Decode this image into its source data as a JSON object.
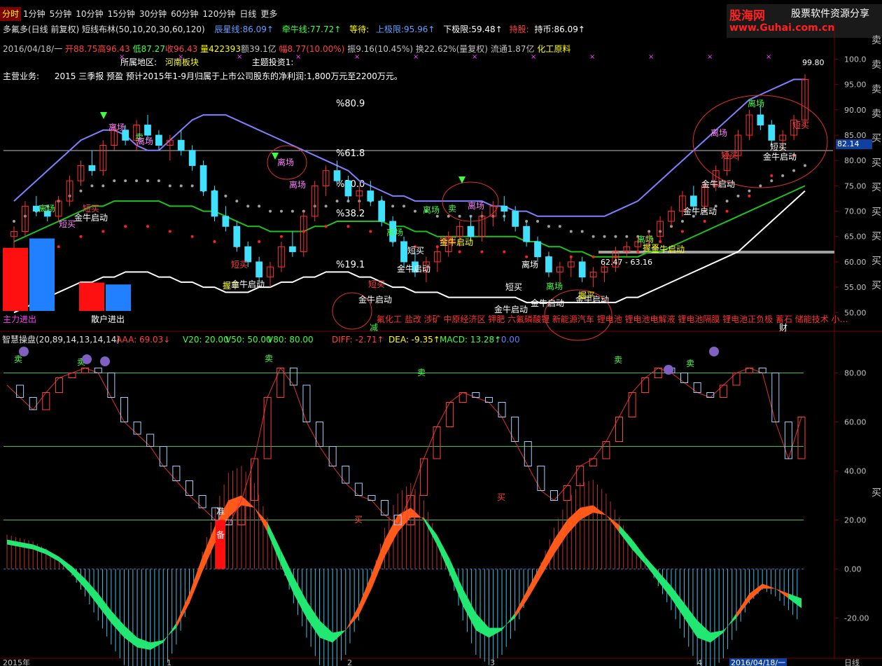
{
  "tabs": [
    "分时",
    "1分钟",
    "5分钟",
    "10分钟",
    "15分钟",
    "30分钟",
    "60分钟",
    "120分钟",
    "日线",
    "更多"
  ],
  "active_tab": "分时",
  "logo": {
    "name": "股海网",
    "tagline": "股票软件资源分享",
    "url": "www.Guhai.com.cn"
  },
  "info": {
    "indicator_title": "多氟多(日线 前复权) 短线布林(50,10,20,30,60,120)",
    "chenxing_label": "辰星线:",
    "chenxing_value": "86.09↑",
    "qianniu_label": "牵牛线:",
    "qianniu_value": "77.72↑",
    "dengdai_label": "等待:",
    "upper_label": "上极限:",
    "upper_value": "95.96↑",
    "lower_label": "下极限:",
    "lower_value": "59.48↑",
    "chigu_label": "持股:",
    "chishi_label": "持币:",
    "chishi_value": "86.09↑",
    "date": "2016/04/18/一",
    "open": "开88.75",
    "high": "高96.43",
    "low": "低87.27",
    "close": "收96.43",
    "volume": "量422393",
    "amount": "额39.1亿",
    "change": "幅8.77(10.00%)",
    "amplitude": "振9.16(10.45%)",
    "turnover": "换22.62%(量复权)",
    "float": "流通1.87亿",
    "industry": "化工原料",
    "region_label": "所属地区:",
    "region_value": "河南板块",
    "theme_label": "主题投资1:",
    "business_label": "主营业务:",
    "business_text": "2015 三季报 预盈 预计2015年1-9月归属于上市公司股东的净利润:1,800万元至2200万元。"
  },
  "fib_labels": [
    "%80.9",
    "%61.8",
    "%50.0",
    "%38.2",
    "%19.1"
  ],
  "price_tag": "82.14",
  "range_label": "62.47 - 63.16",
  "peak_label": "99.80",
  "concepts": "氟化工 盐改 涉矿 中原经济区 钾肥 六氟磷酸锂 新能源汽车 锂电池 锂电池电解液 锂电池隔膜 锂电池正负极 蓄石 储能技术 小…",
  "main_markers": {
    "likai": "离场",
    "maichu": "卖",
    "duanmai": "短买",
    "jinniu": "金牛启动",
    "wodi": "握平",
    "jian": "减",
    "cai": "财"
  },
  "bars_legend": "散户进出",
  "bars_left_label": "主力进出",
  "bottom_indicator": {
    "title": "智慧操盘(20,89,14,13,14,14)",
    "aaa": "AAA: 69.03↓",
    "v20": "V20: 20.00",
    "v50": "V50: 50.00",
    "v80": "V80: 80.00",
    "diff": "DIFF: -2.71↑",
    "dea": "DEA: -9.35↑",
    "macd": "MACD: 13.28↑",
    "macd2": ": 0.00",
    "markers": {
      "sell": "卖",
      "buy": "买",
      "zhun": "准",
      "bei": "备"
    }
  },
  "right_side_labels": {
    "buy": "买",
    "sell": "卖"
  },
  "time_axis": [
    "2015年",
    "1",
    "2",
    "3",
    "4",
    "2016/04/18/一",
    "日线"
  ],
  "chart_data": [
    {
      "type": "candlestick",
      "title": "多氟多(日线 前复权) 短线布林(50,10,20,30,60,120)",
      "ylim": [
        47,
        102
      ],
      "y_ticks": [
        50,
        55,
        60,
        65,
        70,
        75,
        80,
        85,
        90,
        95,
        100
      ],
      "y_tick_labels": [
        "50.00",
        "55.00",
        "60.00",
        "65.00",
        "70.00",
        "75.00",
        "80.00",
        "85.00",
        "90.00",
        "95.00",
        "100.0"
      ],
      "candles": [
        [
          65,
          67,
          62,
          66
        ],
        [
          66,
          72,
          65,
          71
        ],
        [
          71,
          73,
          69,
          70
        ],
        [
          70,
          71,
          68,
          69
        ],
        [
          69,
          73,
          68,
          72
        ],
        [
          72,
          77,
          71,
          76
        ],
        [
          76,
          80,
          75,
          79
        ],
        [
          79,
          82,
          77,
          78
        ],
        [
          78,
          84,
          77,
          83
        ],
        [
          83,
          87,
          82,
          86
        ],
        [
          86,
          87,
          83,
          84
        ],
        [
          84,
          88,
          82,
          87
        ],
        [
          87,
          89,
          84,
          85
        ],
        [
          85,
          86,
          82,
          83
        ],
        [
          83,
          85,
          80,
          84
        ],
        [
          84,
          86,
          81,
          82
        ],
        [
          82,
          83,
          78,
          79
        ],
        [
          79,
          80,
          73,
          74
        ],
        [
          74,
          75,
          68,
          69
        ],
        [
          69,
          71,
          66,
          67
        ],
        [
          67,
          68,
          62,
          63
        ],
        [
          63,
          64,
          59,
          60
        ],
        [
          60,
          61,
          56,
          57
        ],
        [
          57,
          60,
          55,
          59
        ],
        [
          59,
          64,
          58,
          63
        ],
        [
          63,
          66,
          61,
          62
        ],
        [
          62,
          70,
          61,
          69
        ],
        [
          69,
          76,
          68,
          75
        ],
        [
          75,
          79,
          73,
          78
        ],
        [
          78,
          80,
          75,
          76
        ],
        [
          76,
          77,
          72,
          73
        ],
        [
          73,
          75,
          70,
          74
        ],
        [
          74,
          76,
          71,
          72
        ],
        [
          72,
          73,
          67,
          68
        ],
        [
          68,
          69,
          63,
          64
        ],
        [
          64,
          65,
          59,
          60
        ],
        [
          60,
          62,
          57,
          58
        ],
        [
          58,
          61,
          56,
          60
        ],
        [
          60,
          63,
          58,
          62
        ],
        [
          62,
          66,
          61,
          65
        ],
        [
          65,
          68,
          63,
          67
        ],
        [
          67,
          69,
          64,
          65
        ],
        [
          65,
          70,
          64,
          69
        ],
        [
          69,
          72,
          67,
          71
        ],
        [
          71,
          73,
          68,
          70
        ],
        [
          70,
          71,
          66,
          67
        ],
        [
          67,
          68,
          63,
          64
        ],
        [
          64,
          65,
          60,
          61
        ],
        [
          61,
          62,
          57,
          58
        ],
        [
          58,
          60,
          56,
          59
        ],
        [
          59,
          61,
          57,
          60
        ],
        [
          60,
          61,
          56,
          57
        ],
        [
          57,
          59,
          55,
          58
        ],
        [
          58,
          60,
          56,
          59
        ],
        [
          59,
          63,
          58,
          62
        ],
        [
          62,
          64,
          61,
          63
        ],
        [
          63,
          65,
          62,
          64
        ],
        [
          64,
          66,
          63,
          65
        ],
        [
          65,
          69,
          64,
          68
        ],
        [
          68,
          71,
          67,
          70
        ],
        [
          70,
          74,
          69,
          73
        ],
        [
          73,
          75,
          70,
          71
        ],
        [
          71,
          76,
          70,
          75
        ],
        [
          75,
          79,
          74,
          78
        ],
        [
          78,
          82,
          77,
          81
        ],
        [
          81,
          86,
          80,
          85
        ],
        [
          85,
          90,
          84,
          89
        ],
        [
          89,
          91,
          86,
          87
        ],
        [
          87,
          88,
          83,
          84
        ],
        [
          84,
          86,
          82,
          85
        ],
        [
          85,
          89,
          84,
          88
        ],
        [
          88,
          97,
          87,
          96
        ]
      ],
      "upper_band": [
        72,
        74,
        76,
        78,
        80,
        82,
        84,
        85,
        86,
        86,
        85,
        83,
        82,
        82,
        84,
        86,
        88,
        89,
        89,
        89,
        88,
        87,
        86,
        85,
        84,
        83,
        82,
        81,
        80,
        79,
        78,
        76,
        75,
        74,
        73,
        73,
        72,
        72,
        72,
        72,
        72,
        72,
        72,
        71,
        71,
        70,
        70,
        69,
        69,
        69,
        69,
        69,
        69,
        69,
        70,
        71,
        72,
        74,
        76,
        78,
        80,
        82,
        84,
        86,
        88,
        90,
        92,
        93,
        94,
        95,
        96,
        96
      ],
      "mid_band": [
        64,
        65,
        66,
        67,
        68,
        69,
        70,
        71,
        71,
        72,
        72,
        72,
        72,
        72,
        71,
        71,
        71,
        70,
        70,
        69,
        68,
        67,
        67,
        66,
        66,
        66,
        66,
        67,
        67,
        68,
        68,
        68,
        68,
        68,
        67,
        67,
        66,
        66,
        65,
        65,
        65,
        65,
        65,
        65,
        65,
        65,
        64,
        64,
        63,
        63,
        62,
        62,
        61,
        61,
        61,
        61,
        61,
        62,
        62,
        63,
        64,
        65,
        66,
        67,
        68,
        69,
        70,
        71,
        72,
        73,
        74,
        75
      ],
      "lower_band": [
        50,
        51,
        52,
        53,
        54,
        55,
        56,
        56,
        57,
        57,
        58,
        58,
        58,
        57,
        57,
        56,
        56,
        55,
        55,
        54,
        54,
        54,
        55,
        55,
        56,
        56,
        57,
        57,
        58,
        58,
        58,
        57,
        57,
        56,
        55,
        55,
        54,
        54,
        54,
        53,
        53,
        53,
        53,
        53,
        53,
        53,
        52,
        52,
        52,
        52,
        52,
        52,
        52,
        52,
        52,
        53,
        53,
        54,
        55,
        56,
        57,
        58,
        59,
        60,
        61,
        62,
        64,
        66,
        68,
        70,
        72,
        74
      ]
    },
    {
      "type": "bar",
      "title": "散户进出",
      "series": [
        {
          "name": "主力进出",
          "values": [
            1.0,
            1.15
          ]
        },
        {
          "name": "散户进出",
          "values": [
            0.45,
            0.42
          ]
        }
      ]
    },
    {
      "type": "area",
      "title": "智慧操盘(20,89,14,13,14,14)",
      "ylim": [
        -35,
        95
      ],
      "y_ticks": [
        -20,
        0,
        20,
        40,
        60,
        80
      ],
      "y_tick_labels": [
        "-20.00",
        "0.00",
        "20.00",
        "40.00",
        "60.00",
        "80.00"
      ],
      "reference_lines": [
        20,
        50,
        80
      ],
      "series": [
        {
          "name": "DIFF",
          "values": [
            10,
            9,
            8,
            6,
            3,
            -2,
            -8,
            -15,
            -22,
            -28,
            -32,
            -33,
            -30,
            -22,
            -10,
            5,
            18,
            28,
            30,
            25,
            15,
            2,
            -10,
            -20,
            -28,
            -30,
            -25,
            -15,
            -2,
            12,
            22,
            25,
            20,
            10,
            -2,
            -15,
            -25,
            -28,
            -25,
            -18,
            -8,
            2,
            12,
            20,
            25,
            26,
            22,
            15,
            8,
            2,
            -5,
            -12,
            -20,
            -28,
            -30,
            -26,
            -18,
            -10,
            -6,
            -8,
            -12,
            -16
          ]
        },
        {
          "name": "DEA",
          "values": [
            12,
            11,
            10,
            8,
            5,
            1,
            -4,
            -10,
            -17,
            -23,
            -28,
            -30,
            -29,
            -24,
            -14,
            -1,
            11,
            21,
            26,
            25,
            19,
            8,
            -3,
            -13,
            -21,
            -26,
            -25,
            -19,
            -8,
            5,
            15,
            21,
            21,
            14,
            4,
            -8,
            -18,
            -24,
            -24,
            -20,
            -12,
            -3,
            6,
            14,
            20,
            23,
            22,
            18,
            12,
            5,
            -1,
            -7,
            -14,
            -21,
            -26,
            -25,
            -20,
            -13,
            -8,
            -8,
            -10,
            -12
          ]
        },
        {
          "name": "AAA",
          "values": [
            75,
            70,
            65,
            72,
            78,
            80,
            82,
            80,
            70,
            60,
            55,
            50,
            42,
            36,
            30,
            25,
            20,
            18,
            28,
            45,
            70,
            82,
            75,
            60,
            50,
            42,
            35,
            30,
            28,
            22,
            18,
            30,
            45,
            58,
            68,
            72,
            70,
            68,
            62,
            52,
            42,
            32,
            28,
            34,
            42,
            45,
            52,
            62,
            72,
            78,
            82,
            80,
            76,
            72,
            70,
            75,
            80,
            82,
            80,
            60,
            45,
            62
          ]
        }
      ]
    }
  ]
}
